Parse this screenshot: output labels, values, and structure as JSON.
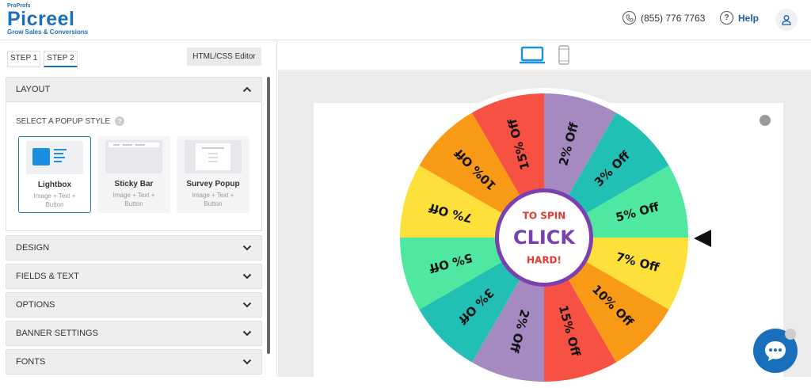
{
  "header": {
    "logo_small": "ProProfs",
    "logo_name": "Picreel",
    "logo_tagline": "Grow Sales & Conversions",
    "phone": "(855) 776 7763",
    "help": "Help"
  },
  "left_panel": {
    "tabs": [
      {
        "label": "STEP 1"
      },
      {
        "label": "STEP 2",
        "active": true
      }
    ],
    "editor_button": "HTML/CSS Editor",
    "sections": {
      "layout": "LAYOUT",
      "design": "DESIGN",
      "fields_text": "FIELDS & TEXT",
      "options": "OPTIONS",
      "banner_settings": "BANNER SETTINGS",
      "fonts": "FONTS"
    },
    "select_style_label": "SELECT A POPUP STYLE",
    "styles": [
      {
        "name": "Lightbox",
        "sub": "Image + Text + Button",
        "selected": true
      },
      {
        "name": "Sticky Bar",
        "sub": "Image + Text + Button"
      },
      {
        "name": "Survey Popup",
        "sub": "Image + Text + Button"
      }
    ]
  },
  "preview": {
    "devices": [
      "laptop-icon",
      "mobile-icon"
    ],
    "wheel": {
      "center_top": "TO SPIN",
      "center_main": "CLICK",
      "center_bottom": "HARD!",
      "segments": [
        {
          "label": "2% Off",
          "color": "#a58ac1"
        },
        {
          "label": "3% Off",
          "color": "#22bfb5"
        },
        {
          "label": "5% Off",
          "color": "#4ee8a0"
        },
        {
          "label": "7% Off",
          "color": "#fde03a"
        },
        {
          "label": "10% Off",
          "color": "#f99a17"
        },
        {
          "label": "15% Off",
          "color": "#f65143"
        },
        {
          "label": "2% Off",
          "color": "#a58ac1"
        },
        {
          "label": "3% Off",
          "color": "#22bfb5"
        },
        {
          "label": "5% Off",
          "color": "#4ee8a0"
        },
        {
          "label": "7% Off",
          "color": "#fde03a"
        },
        {
          "label": "10% Off",
          "color": "#f99a17"
        },
        {
          "label": "15% Off",
          "color": "#f65143"
        }
      ]
    }
  },
  "colors": {
    "brand": "#1a6fbd",
    "center_ring": "#7b3fb0",
    "spin_text": "#e53935"
  }
}
